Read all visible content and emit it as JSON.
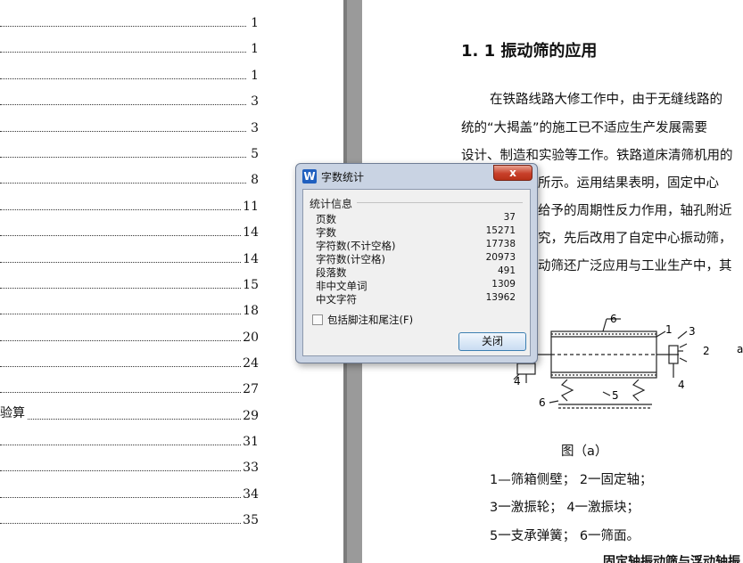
{
  "toc": {
    "rows": [
      {
        "label": "",
        "page": "1"
      },
      {
        "label": "",
        "page": "1"
      },
      {
        "label": "",
        "page": "1"
      },
      {
        "label": "",
        "page": "3"
      },
      {
        "label": "",
        "page": "3"
      },
      {
        "label": "",
        "page": "5"
      },
      {
        "label": "",
        "page": "8"
      },
      {
        "label": "",
        "page": "11"
      },
      {
        "label": "",
        "page": "14"
      },
      {
        "label": "",
        "page": "14"
      },
      {
        "label": "",
        "page": "15"
      },
      {
        "label": "",
        "page": "18"
      },
      {
        "label": "",
        "page": "20"
      },
      {
        "label": "",
        "page": "24"
      },
      {
        "label": "",
        "page": "27"
      },
      {
        "label": "验算",
        "page": "29"
      },
      {
        "label": "",
        "page": "31"
      },
      {
        "label": "",
        "page": "33"
      },
      {
        "label": "",
        "page": "34"
      },
      {
        "label": "",
        "page": "35"
      }
    ]
  },
  "document": {
    "heading": "1. 1 振动筛的应用",
    "lines": [
      "在铁路线路大修工作中，由于无缝线路的",
      "统的“大揭盖”的施工已不适应生产发展需要",
      "设计、制造和实验等工作。铁路道床清筛机用的",
      "所示。运用结果表明，固定中心",
      "给予的周期性反力作用，轴孔附近",
      "究，先后改用了自定中心振动筛，",
      "动筛还广泛应用与工业生产中，其"
    ],
    "figure_labels": [
      "6",
      "1",
      "3",
      "2",
      "a",
      "4",
      "4",
      "5",
      "6"
    ],
    "figure_caption": "图（a）",
    "legend": [
      "1—筛箱侧壁；   2一固定轴；",
      "3一激振轮；     4一激振块；",
      "5一支承弹簧；   6一筛面。"
    ],
    "bottom_cut": "固定轴振动筛与浮动轴振"
  },
  "dialog": {
    "app_icon_letter": "W",
    "title": "字数统计",
    "close_x": "x",
    "group_label": "统计信息",
    "stats": [
      {
        "name": "页数",
        "value": "37"
      },
      {
        "name": "字数",
        "value": "15271"
      },
      {
        "name": "字符数(不计空格)",
        "value": "17738"
      },
      {
        "name": "字符数(计空格)",
        "value": "20973"
      },
      {
        "name": "段落数",
        "value": "491"
      },
      {
        "name": "非中文单词",
        "value": "1309"
      },
      {
        "name": "中文字符",
        "value": "13962"
      }
    ],
    "include_label": "包括脚注和尾注(F)",
    "include_checked": false,
    "close_button": "关闭"
  }
}
